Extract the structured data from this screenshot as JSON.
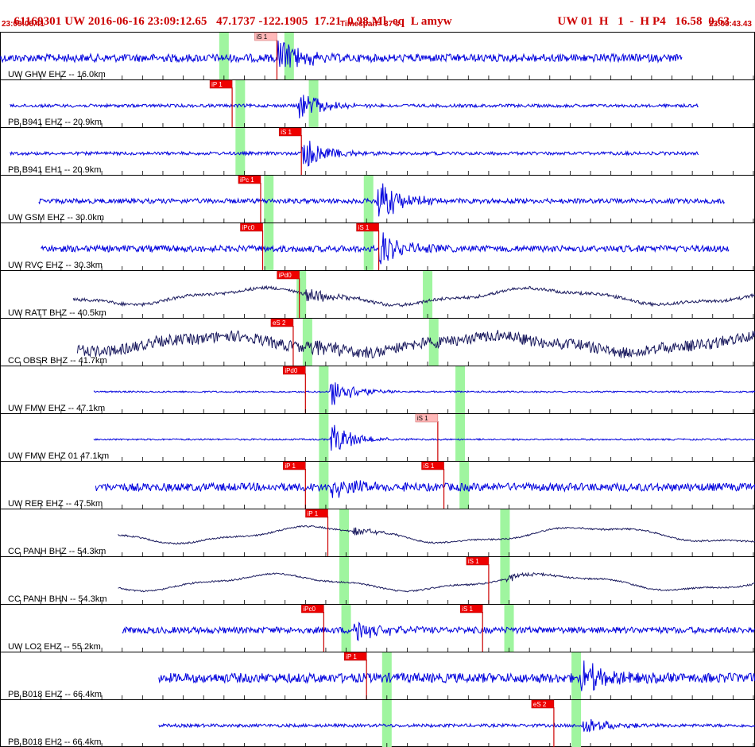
{
  "header": {
    "title_left": "61169301 UW 2016-06-16 23:09:12.65   47.1737 -122.1905  17.21  0.98 Ml  eq  L amyw",
    "title_right": "UW 01  H   1  -  H P4   16.58  0.63",
    "start_time": "23:09:06.41",
    "timespan": "Timespan=  37 s",
    "end_time": "23:09:43.43"
  },
  "colors": {
    "accent_red": "#cc0000",
    "trace_blue": "#0000dd",
    "trace_dark": "#1a1a5e",
    "pick_window": "#9ff59f",
    "pick_label_bg": "#ee0000",
    "pick_label_light": "#ffb8b8"
  },
  "chart_data": {
    "type": "seismogram",
    "time_range_s": [
      0,
      37
    ],
    "tick_interval_s": 1,
    "traces": [
      {
        "label": "UW GHW EHZ -- 16.0km",
        "color": "blue",
        "noise": 5,
        "start": 0.0,
        "end": 33.5,
        "burst": 13.6,
        "amp": 28,
        "picks": [
          {
            "label": "iS 1",
            "t": 13.6,
            "style": "light"
          }
        ],
        "windows": [
          11.0,
          14.2
        ],
        "extra_windows": []
      },
      {
        "label": "PB B941 EHZ -- 20.9km",
        "color": "blue",
        "noise": 2,
        "start": 0.5,
        "end": 34.3,
        "burst": 14.6,
        "amp": 22,
        "picks": [
          {
            "label": "iP 1",
            "t": 11.4,
            "style": "red"
          }
        ],
        "windows": [
          11.8,
          15.4
        ],
        "extra_windows": []
      },
      {
        "label": "PB B941 EH1 -- 20.9km",
        "color": "blue",
        "noise": 2,
        "start": 0.5,
        "end": 34.3,
        "burst": 14.8,
        "amp": 25,
        "picks": [
          {
            "label": "iS 1",
            "t": 14.8,
            "style": "red"
          }
        ],
        "windows": [
          11.8
        ],
        "extra_windows": []
      },
      {
        "label": "UW GSM EHZ -- 30.0km",
        "color": "blue",
        "noise": 3,
        "start": 1.9,
        "end": 35.6,
        "burst": 18.5,
        "amp": 30,
        "picks": [
          {
            "label": "iPc 1",
            "t": 12.8,
            "style": "red"
          }
        ],
        "windows": [
          13.2,
          18.1
        ],
        "extra_windows": []
      },
      {
        "label": "UW RVC EHZ -- 30.3km",
        "color": "blue",
        "noise": 4,
        "start": 2.0,
        "end": 35.8,
        "burst": 18.6,
        "amp": 27,
        "picks": [
          {
            "label": "iPc0",
            "t": 12.9,
            "style": "red"
          },
          {
            "label": "iS 1",
            "t": 18.6,
            "style": "red"
          }
        ],
        "windows": [
          13.2,
          18.1
        ],
        "extra_windows": []
      },
      {
        "label": "UW RATT BHZ -- 40.5km",
        "color": "dark",
        "noise": 2,
        "start": 3.6,
        "end": 37.3,
        "burst": 15.0,
        "amp": 12,
        "picks": [
          {
            "label": "iPd0",
            "t": 14.7,
            "style": "red"
          }
        ],
        "windows": [
          14.8,
          21.0
        ],
        "extra_windows": []
      },
      {
        "label": "CC OBSR BHZ -- 41.7km",
        "color": "dark",
        "noise": 7,
        "start": 3.8,
        "end": 37.4,
        "burst": 15.2,
        "amp": 10,
        "picks": [
          {
            "label": "eS 2",
            "t": 14.4,
            "style": "red"
          }
        ],
        "windows": [
          15.1,
          21.3
        ],
        "extra_windows": []
      },
      {
        "label": "UW FMW EHZ -- 47.1km",
        "color": "blue",
        "noise": 1,
        "start": 4.6,
        "end": 38.4,
        "burst": 16.2,
        "amp": 22,
        "picks": [
          {
            "label": "iPd0",
            "t": 15.0,
            "style": "red"
          }
        ],
        "windows": [
          15.9,
          22.6
        ],
        "extra_windows": []
      },
      {
        "label": "UW FMW EHZ 01 47.1km",
        "color": "blue",
        "noise": 1,
        "start": 4.6,
        "end": 38.4,
        "burst": 16.2,
        "amp": 22,
        "picks": [
          {
            "label": "iS 1",
            "t": 21.5,
            "style": "light"
          }
        ],
        "windows": [
          15.9,
          22.6
        ],
        "extra_windows": []
      },
      {
        "label": "UW RER EHZ -- 47.5km",
        "color": "blue",
        "noise": 5,
        "start": 4.7,
        "end": 38.5,
        "burst": 16.2,
        "amp": 18,
        "picks": [
          {
            "label": "iP 1",
            "t": 15.0,
            "style": "red"
          },
          {
            "label": "iS 1",
            "t": 21.8,
            "style": "red"
          }
        ],
        "windows": [
          15.9,
          22.8
        ],
        "extra_windows": []
      },
      {
        "label": "CC PANH BHZ -- 54.3km",
        "color": "dark",
        "noise": 1,
        "start": 5.8,
        "end": 39.5,
        "burst": 17.3,
        "amp": 6,
        "picks": [
          {
            "label": "iP 1",
            "t": 16.1,
            "style": "red"
          }
        ],
        "windows": [
          16.9,
          24.8
        ],
        "extra_windows": []
      },
      {
        "label": "CC PANH BHN -- 54.3km",
        "color": "dark",
        "noise": 1,
        "start": 5.8,
        "end": 39.5,
        "burst": 24.8,
        "amp": 6,
        "picks": [
          {
            "label": "iS 1",
            "t": 24.0,
            "style": "red"
          }
        ],
        "windows": [
          16.9,
          24.8
        ],
        "extra_windows": []
      },
      {
        "label": "UW LO2 EHZ -- 55.2km",
        "color": "blue",
        "noise": 4,
        "start": 6.0,
        "end": 39.7,
        "burst": 17.3,
        "amp": 17,
        "picks": [
          {
            "label": "iPc0",
            "t": 15.9,
            "style": "red"
          },
          {
            "label": "iS 1",
            "t": 23.7,
            "style": "red"
          }
        ],
        "windows": [
          17.0,
          25.0
        ],
        "extra_windows": []
      },
      {
        "label": "PB B018 EHZ -- 66.4km",
        "color": "blue",
        "noise": 6,
        "start": 7.8,
        "end": 41.5,
        "burst": 28.5,
        "amp": 26,
        "picks": [
          {
            "label": "iP 1",
            "t": 18.0,
            "style": "red"
          }
        ],
        "windows": [
          19.0,
          28.3
        ],
        "extra_windows": []
      },
      {
        "label": "PB B018 EH2 -- 66.4km",
        "color": "blue",
        "noise": 2,
        "start": 7.8,
        "end": 41.5,
        "burst": 28.6,
        "amp": 14,
        "picks": [
          {
            "label": "eS 2",
            "t": 27.2,
            "style": "red"
          }
        ],
        "windows": [
          19.0,
          28.3
        ],
        "extra_windows": []
      }
    ]
  }
}
